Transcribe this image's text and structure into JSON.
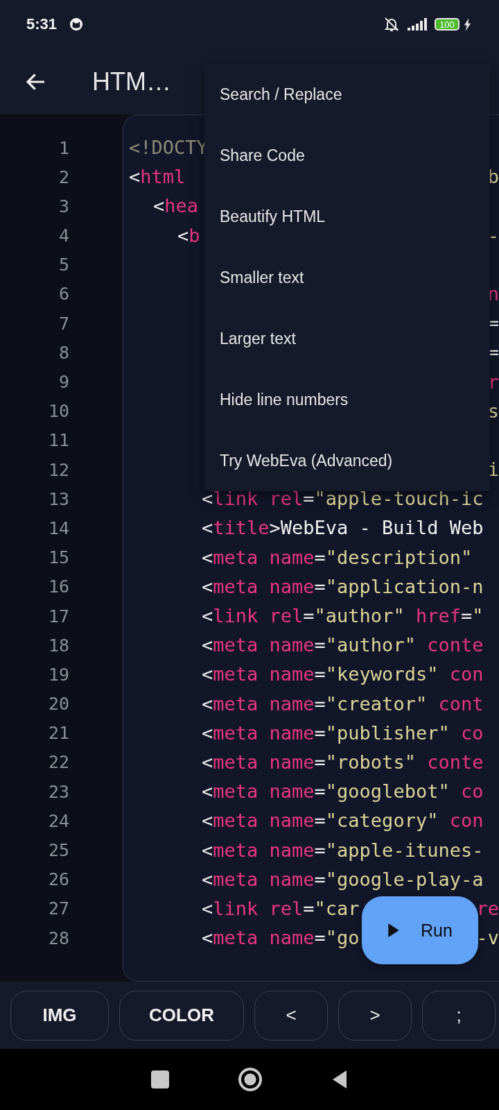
{
  "status_bar": {
    "time": "5:31",
    "battery": "100"
  },
  "app_bar": {
    "title": "HTM…"
  },
  "editor": {
    "lines": [
      {
        "number": "1",
        "code": [
          {
            "kind": "doctype",
            "text": "<!DOCTY"
          }
        ]
      },
      {
        "number": "2",
        "code": [
          {
            "kind": "punct",
            "text": "<"
          },
          {
            "kind": "tag",
            "text": "html"
          }
        ],
        "code_right": [
          {
            "kind": "string",
            "text": "b"
          }
        ],
        "children": [
          {
            "number": "3",
            "code": [
              {
                "kind": "punct",
                "text": "<"
              },
              {
                "kind": "tag",
                "text": "hea"
              }
            ],
            "children": [
              {
                "number": "4",
                "code": [
                  {
                    "kind": "punct",
                    "text": "<"
                  },
                  {
                    "kind": "tag",
                    "text": "b"
                  }
                ],
                "code_right": [
                  {
                    "kind": "string",
                    "text": "-"
                  }
                ],
                "children": [
                  {
                    "number": "5"
                  },
                  {
                    "number": "6",
                    "code_right": [
                      {
                        "kind": "tag",
                        "text": "n"
                      }
                    ]
                  },
                  {
                    "number": "7",
                    "code_right": [
                      {
                        "kind": "punct",
                        "text": "="
                      }
                    ]
                  },
                  {
                    "number": "8",
                    "code_right": [
                      {
                        "kind": "punct",
                        "text": "="
                      }
                    ]
                  },
                  {
                    "number": "9",
                    "code_right": [
                      {
                        "kind": "tag",
                        "text": "r"
                      }
                    ]
                  },
                  {
                    "number": "10",
                    "code_right": [
                      {
                        "kind": "string",
                        "text": "s"
                      }
                    ]
                  },
                  {
                    "number": "11"
                  },
                  {
                    "number": "12",
                    "code_right": [
                      {
                        "kind": "string",
                        "text": "i"
                      }
                    ]
                  },
                  {
                    "number": "13",
                    "code": [
                      {
                        "kind": "punct",
                        "text": "<"
                      },
                      {
                        "kind": "tag",
                        "text": "link "
                      },
                      {
                        "kind": "tag",
                        "text": "rel"
                      },
                      {
                        "kind": "punct",
                        "text": "="
                      },
                      {
                        "kind": "string",
                        "text": "\"apple-touch-ic"
                      }
                    ]
                  },
                  {
                    "number": "14",
                    "code": [
                      {
                        "kind": "punct",
                        "text": "<"
                      },
                      {
                        "kind": "tag",
                        "text": "title"
                      },
                      {
                        "kind": "punct",
                        "text": ">"
                      },
                      {
                        "kind": "text",
                        "text": "WebEva - Build Web"
                      }
                    ]
                  },
                  {
                    "number": "15",
                    "code": [
                      {
                        "kind": "punct",
                        "text": "<"
                      },
                      {
                        "kind": "tag",
                        "text": "meta "
                      },
                      {
                        "kind": "tag",
                        "text": "name"
                      },
                      {
                        "kind": "punct",
                        "text": "="
                      },
                      {
                        "kind": "string",
                        "text": "\"description\""
                      }
                    ]
                  },
                  {
                    "number": "16",
                    "code": [
                      {
                        "kind": "punct",
                        "text": "<"
                      },
                      {
                        "kind": "tag",
                        "text": "meta "
                      },
                      {
                        "kind": "tag",
                        "text": "name"
                      },
                      {
                        "kind": "punct",
                        "text": "="
                      },
                      {
                        "kind": "string",
                        "text": "\"application-n"
                      }
                    ]
                  },
                  {
                    "number": "17",
                    "code": [
                      {
                        "kind": "punct",
                        "text": "<"
                      },
                      {
                        "kind": "tag",
                        "text": "link "
                      },
                      {
                        "kind": "tag",
                        "text": "rel"
                      },
                      {
                        "kind": "punct",
                        "text": "="
                      },
                      {
                        "kind": "string",
                        "text": "\"author\" "
                      },
                      {
                        "kind": "tag",
                        "text": "href"
                      },
                      {
                        "kind": "punct",
                        "text": "="
                      },
                      {
                        "kind": "string",
                        "text": "\""
                      }
                    ]
                  },
                  {
                    "number": "18",
                    "code": [
                      {
                        "kind": "punct",
                        "text": "<"
                      },
                      {
                        "kind": "tag",
                        "text": "meta "
                      },
                      {
                        "kind": "tag",
                        "text": "name"
                      },
                      {
                        "kind": "punct",
                        "text": "="
                      },
                      {
                        "kind": "string",
                        "text": "\"author\" "
                      },
                      {
                        "kind": "tag",
                        "text": "conte"
                      }
                    ]
                  },
                  {
                    "number": "19",
                    "code": [
                      {
                        "kind": "punct",
                        "text": "<"
                      },
                      {
                        "kind": "tag",
                        "text": "meta "
                      },
                      {
                        "kind": "tag",
                        "text": "name"
                      },
                      {
                        "kind": "punct",
                        "text": "="
                      },
                      {
                        "kind": "string",
                        "text": "\"keywords\" "
                      },
                      {
                        "kind": "tag",
                        "text": "con"
                      }
                    ]
                  },
                  {
                    "number": "20",
                    "code": [
                      {
                        "kind": "punct",
                        "text": "<"
                      },
                      {
                        "kind": "tag",
                        "text": "meta "
                      },
                      {
                        "kind": "tag",
                        "text": "name"
                      },
                      {
                        "kind": "punct",
                        "text": "="
                      },
                      {
                        "kind": "string",
                        "text": "\"creator\" "
                      },
                      {
                        "kind": "tag",
                        "text": "cont"
                      }
                    ]
                  },
                  {
                    "number": "21",
                    "code": [
                      {
                        "kind": "punct",
                        "text": "<"
                      },
                      {
                        "kind": "tag",
                        "text": "meta "
                      },
                      {
                        "kind": "tag",
                        "text": "name"
                      },
                      {
                        "kind": "punct",
                        "text": "="
                      },
                      {
                        "kind": "string",
                        "text": "\"publisher\" "
                      },
                      {
                        "kind": "tag",
                        "text": "co"
                      }
                    ]
                  },
                  {
                    "number": "22",
                    "code": [
                      {
                        "kind": "punct",
                        "text": "<"
                      },
                      {
                        "kind": "tag",
                        "text": "meta "
                      },
                      {
                        "kind": "tag",
                        "text": "name"
                      },
                      {
                        "kind": "punct",
                        "text": "="
                      },
                      {
                        "kind": "string",
                        "text": "\"robots\" "
                      },
                      {
                        "kind": "tag",
                        "text": "conte"
                      }
                    ]
                  },
                  {
                    "number": "23",
                    "code": [
                      {
                        "kind": "punct",
                        "text": "<"
                      },
                      {
                        "kind": "tag",
                        "text": "meta "
                      },
                      {
                        "kind": "tag",
                        "text": "name"
                      },
                      {
                        "kind": "punct",
                        "text": "="
                      },
                      {
                        "kind": "string",
                        "text": "\"googlebot\" "
                      },
                      {
                        "kind": "tag",
                        "text": "co"
                      }
                    ]
                  },
                  {
                    "number": "24",
                    "code": [
                      {
                        "kind": "punct",
                        "text": "<"
                      },
                      {
                        "kind": "tag",
                        "text": "meta "
                      },
                      {
                        "kind": "tag",
                        "text": "name"
                      },
                      {
                        "kind": "punct",
                        "text": "="
                      },
                      {
                        "kind": "string",
                        "text": "\"category\" "
                      },
                      {
                        "kind": "tag",
                        "text": "con"
                      }
                    ]
                  },
                  {
                    "number": "25",
                    "code": [
                      {
                        "kind": "punct",
                        "text": "<"
                      },
                      {
                        "kind": "tag",
                        "text": "meta "
                      },
                      {
                        "kind": "tag",
                        "text": "name"
                      },
                      {
                        "kind": "punct",
                        "text": "="
                      },
                      {
                        "kind": "string",
                        "text": "\"apple-itunes-"
                      }
                    ]
                  },
                  {
                    "number": "26",
                    "code": [
                      {
                        "kind": "punct",
                        "text": "<"
                      },
                      {
                        "kind": "tag",
                        "text": "meta "
                      },
                      {
                        "kind": "tag",
                        "text": "name"
                      },
                      {
                        "kind": "punct",
                        "text": "="
                      },
                      {
                        "kind": "string",
                        "text": "\"google-play-a"
                      }
                    ]
                  },
                  {
                    "number": "27",
                    "code": [
                      {
                        "kind": "punct",
                        "text": "<"
                      },
                      {
                        "kind": "tag",
                        "text": "link "
                      },
                      {
                        "kind": "tag",
                        "text": "rel"
                      },
                      {
                        "kind": "punct",
                        "text": "="
                      },
                      {
                        "kind": "string",
                        "text": "\"car"
                      }
                    ],
                    "code_right": [
                      {
                        "kind": "tag",
                        "text": "re"
                      }
                    ]
                  },
                  {
                    "number": "28",
                    "code": [
                      {
                        "kind": "punct",
                        "text": "<"
                      },
                      {
                        "kind": "tag",
                        "text": "meta "
                      },
                      {
                        "kind": "tag",
                        "text": "name"
                      },
                      {
                        "kind": "punct",
                        "text": "="
                      },
                      {
                        "kind": "string",
                        "text": "\"go"
                      }
                    ],
                    "code_right": [
                      {
                        "kind": "string",
                        "text": "-v"
                      }
                    ]
                  }
                ]
              }
            ]
          }
        ]
      }
    ]
  },
  "menu": {
    "items": [
      "Search / Replace",
      "Share Code",
      "Beautify HTML",
      "Smaller text",
      "Larger text",
      "Hide line numbers",
      "Try WebEva (Advanced)"
    ]
  },
  "run_button": {
    "label": "Run"
  },
  "key_bar": {
    "keys": [
      "IMG",
      "COLOR",
      "<",
      ">",
      ";"
    ]
  }
}
